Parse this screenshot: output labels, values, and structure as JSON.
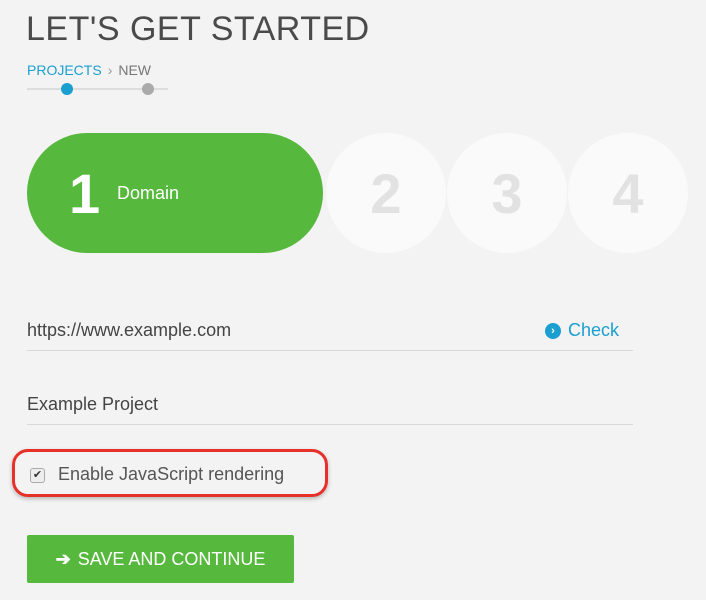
{
  "header": {
    "title": "LET'S GET STARTED"
  },
  "breadcrumb": {
    "parent": "PROJECTS",
    "separator": "›",
    "current": "NEW"
  },
  "progress": {
    "active_step": 1,
    "total_steps": 2,
    "colors": {
      "active": "#1a9fd0",
      "inactive": "#aaaaaa"
    }
  },
  "steps": [
    {
      "number": "1",
      "label": "Domain",
      "active": true
    },
    {
      "number": "2"
    },
    {
      "number": "3"
    },
    {
      "number": "4"
    }
  ],
  "form": {
    "domain_value": "https://www.example.com",
    "check_label": "Check",
    "project_name_value": "Example Project",
    "js_rendering_label": "Enable JavaScript rendering",
    "js_rendering_checked": true,
    "submit_label": "SAVE AND CONTINUE"
  },
  "colors": {
    "brand_green": "#56b83c",
    "link_blue": "#1a9fd0",
    "highlight_red": "#e8302a"
  }
}
